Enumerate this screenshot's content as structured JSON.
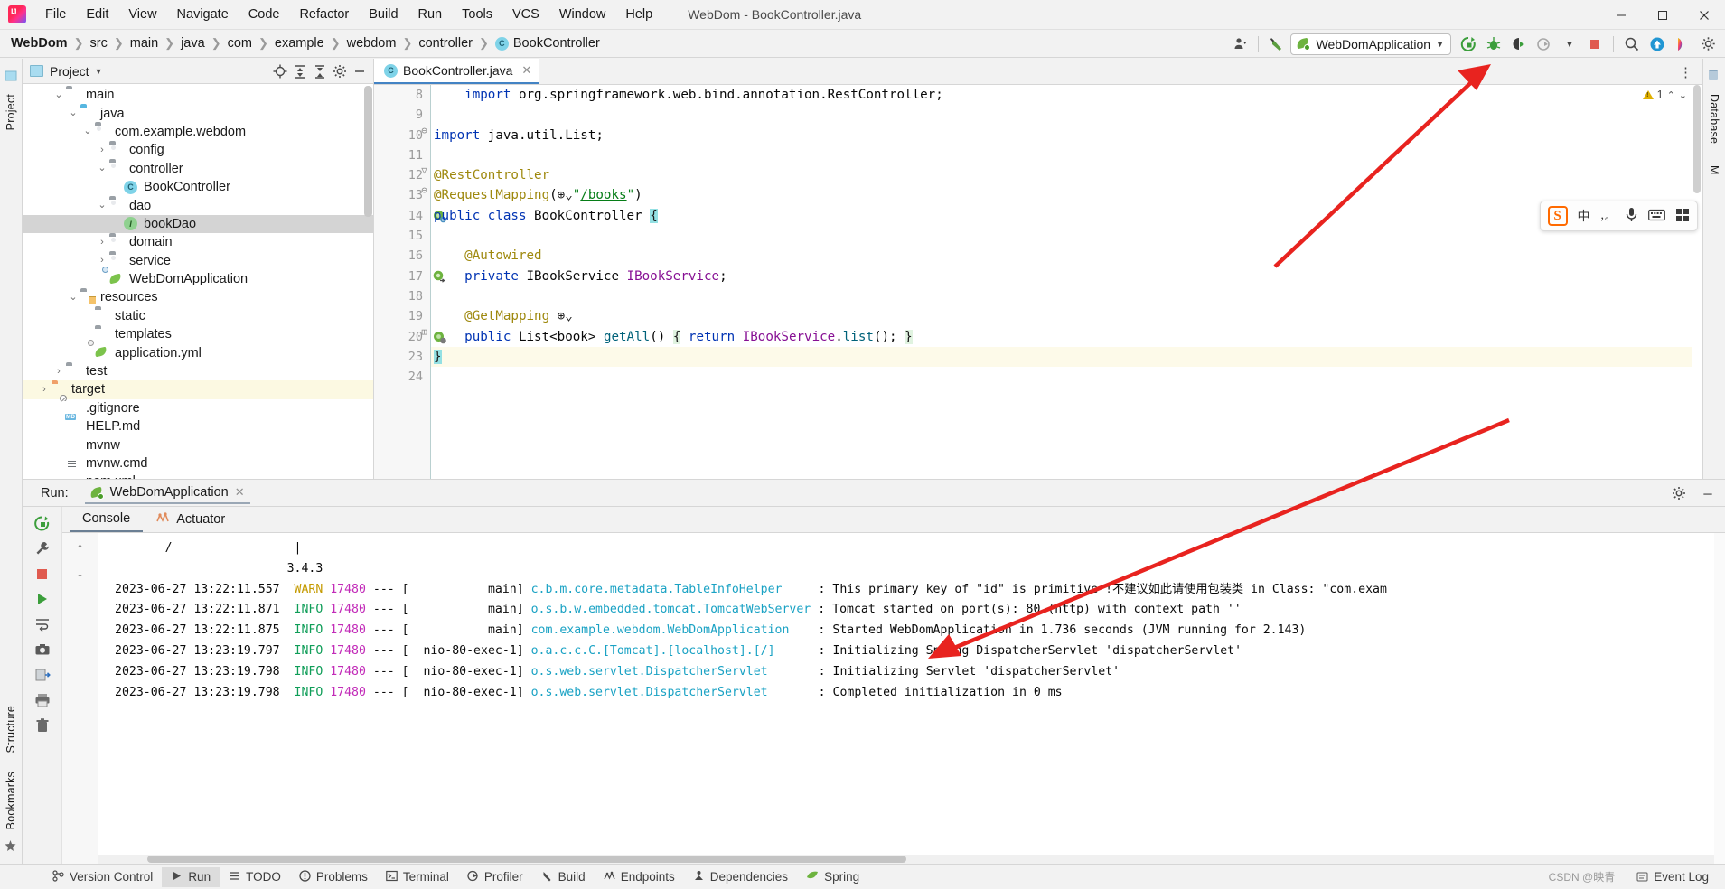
{
  "window": {
    "title": "WebDom - BookController.java",
    "minimize": "─",
    "maximize": "☐",
    "close": "✕"
  },
  "menubar": {
    "items": [
      "File",
      "Edit",
      "View",
      "Navigate",
      "Code",
      "Refactor",
      "Build",
      "Run",
      "Tools",
      "VCS",
      "Window",
      "Help"
    ]
  },
  "breadcrumb": {
    "items": [
      "WebDom",
      "src",
      "main",
      "java",
      "com",
      "example",
      "webdom",
      "controller"
    ],
    "current": "BookController",
    "class_icon": "C"
  },
  "toolbar": {
    "account_icon": "user-icon",
    "hammer_icon": "build-icon",
    "run_config": "WebDomApplication",
    "run_icon": "run-icon",
    "debug_icon": "debug-icon",
    "run_coverage_icon": "run-with-coverage-icon",
    "profiler_icon": "profiler-icon",
    "stop_icon": "stop-icon",
    "search_icon": "search-icon",
    "updates_icon": "updates-icon",
    "ide_icon": "ide-icon",
    "settings_icon": "settings-icon"
  },
  "left_rail": {
    "project_label": "Project",
    "structure_label": "Structure",
    "bookmarks_label": "Bookmarks"
  },
  "right_rail": {
    "database_label": "Database",
    "maven_label": "M"
  },
  "project_panel": {
    "title": "Project",
    "locate_icon": "locate-icon",
    "expand_icon": "expand-all-icon",
    "collapse_icon": "collapse-all-icon",
    "settings_icon": "gear-icon",
    "hide_icon": "hide-icon",
    "tree": [
      {
        "label": "main",
        "depth": 2,
        "twist": "v",
        "icon": "folder-grey",
        "state": ""
      },
      {
        "label": "java",
        "depth": 3,
        "twist": "v",
        "icon": "folder-blue",
        "state": ""
      },
      {
        "label": "com.example.webdom",
        "depth": 4,
        "twist": "v",
        "icon": "folder-pkg",
        "state": ""
      },
      {
        "label": "config",
        "depth": 5,
        "twist": ">",
        "icon": "folder-pkg",
        "state": ""
      },
      {
        "label": "controller",
        "depth": 5,
        "twist": "v",
        "icon": "folder-pkg",
        "state": ""
      },
      {
        "label": "BookController",
        "depth": 6,
        "twist": "",
        "icon": "class",
        "state": ""
      },
      {
        "label": "dao",
        "depth": 5,
        "twist": "v",
        "icon": "folder-pkg",
        "state": ""
      },
      {
        "label": "bookDao",
        "depth": 6,
        "twist": "",
        "icon": "interface",
        "state": "sel"
      },
      {
        "label": "domain",
        "depth": 5,
        "twist": ">",
        "icon": "folder-pkg",
        "state": ""
      },
      {
        "label": "service",
        "depth": 5,
        "twist": ">",
        "icon": "folder-pkg",
        "state": ""
      },
      {
        "label": "WebDomApplication",
        "depth": 5,
        "twist": "",
        "icon": "spring-class",
        "state": ""
      },
      {
        "label": "resources",
        "depth": 3,
        "twist": "v",
        "icon": "folder-res",
        "state": ""
      },
      {
        "label": "static",
        "depth": 4,
        "twist": "",
        "icon": "folder-grey",
        "state": ""
      },
      {
        "label": "templates",
        "depth": 4,
        "twist": "",
        "icon": "folder-grey",
        "state": ""
      },
      {
        "label": "application.yml",
        "depth": 4,
        "twist": "",
        "icon": "spring-yml",
        "state": ""
      },
      {
        "label": "test",
        "depth": 2,
        "twist": ">",
        "icon": "folder-grey",
        "state": ""
      },
      {
        "label": "target",
        "depth": 1,
        "twist": ">",
        "icon": "folder-orange",
        "state": "hl"
      },
      {
        "label": ".gitignore",
        "depth": 2,
        "twist": "",
        "icon": "git-file",
        "state": ""
      },
      {
        "label": "HELP.md",
        "depth": 2,
        "twist": "",
        "icon": "md-file",
        "state": ""
      },
      {
        "label": "mvnw",
        "depth": 2,
        "twist": "",
        "icon": "sh-file",
        "state": ""
      },
      {
        "label": "mvnw.cmd",
        "depth": 2,
        "twist": "",
        "icon": "cmd-file",
        "state": ""
      },
      {
        "label": "pom.xml",
        "depth": 2,
        "twist": "",
        "icon": "maven-file",
        "state": ""
      }
    ]
  },
  "editor": {
    "tab": {
      "label": "BookController.java",
      "icon": "C",
      "close": "✕"
    },
    "kebab": "⋮",
    "inspection": {
      "count": "1",
      "warn_icon": "warning-triangle-icon",
      "up": "⌃",
      "down": "⌄"
    },
    "lines": [
      {
        "no": "8",
        "marker": "",
        "fold": "",
        "text_html": "    <span class='kw'>import</span> <span class='pln'>org.springframework.web.bind.annotation.</span><span class='pln'>RestController</span><span class='pln'>;</span>",
        "current": false
      },
      {
        "no": "9",
        "marker": "",
        "fold": "",
        "text_html": "",
        "current": false
      },
      {
        "no": "10",
        "marker": "",
        "fold": "⊖",
        "text_html": "<span class='kw'>import</span> <span class='pln'>java.util.List;</span>",
        "current": false
      },
      {
        "no": "11",
        "marker": "",
        "fold": "",
        "text_html": "",
        "current": false
      },
      {
        "no": "12",
        "marker": "",
        "fold": "▽",
        "text_html": "<span class='ann'>@RestController</span>",
        "current": false
      },
      {
        "no": "13",
        "marker": "",
        "fold": "⊖",
        "text_html": "<span class='ann'>@RequestMapping</span><span class='pln'>(</span><span class='glb'>⊕⌄</span><span class='str'>\"</span><span class='ulink'>/books</span><span class='str'>\"</span><span class='pln'>)</span>",
        "current": false
      },
      {
        "no": "14",
        "marker": "spring-bean",
        "fold": "",
        "text_html": "<span class='kw'>public class</span> <span class='pln'>BookController</span> <span class='brace-hl'>{</span>",
        "current": false
      },
      {
        "no": "15",
        "marker": "",
        "fold": "",
        "text_html": "",
        "current": false
      },
      {
        "no": "16",
        "marker": "",
        "fold": "",
        "text_html": "    <span class='ann'>@Autowired</span>",
        "current": false
      },
      {
        "no": "17",
        "marker": "spring-arrow",
        "fold": "",
        "text_html": "    <span class='kw'>private</span> <span class='pln'>IBookService</span> <span class='fld'>IBookService</span><span class='pln'>;</span>",
        "current": false
      },
      {
        "no": "18",
        "marker": "",
        "fold": "",
        "text_html": "",
        "current": false
      },
      {
        "no": "19",
        "marker": "",
        "fold": "",
        "text_html": "    <span class='ann'>@GetMapping</span><span class='glb'> ⊕⌄</span>",
        "current": false
      },
      {
        "no": "20",
        "marker": "spring-bean2",
        "fold": "⊞",
        "text_html": "    <span class='kw'>public</span> <span class='pln'>List&lt;book&gt;</span> <span class='mth'>getAll</span><span class='pln'>()</span> <span class='ret-hl'>{</span> <span class='kw'>return</span> <span class='fld'>IBookService</span><span class='pln'>.</span><span class='mth'>list</span><span class='pln'>();</span> <span class='ret-hl'>}</span>",
        "current": false
      },
      {
        "no": "23",
        "marker": "",
        "fold": "",
        "text_html": "<span class='brace-hl'>}</span>",
        "current": true
      },
      {
        "no": "24",
        "marker": "",
        "fold": "",
        "text_html": "",
        "current": false
      }
    ]
  },
  "ime": {
    "logo": "S",
    "lang": "中",
    "comma_icon": "，。",
    "mic_icon": "microphone-icon",
    "keyboard_icon": "keyboard-icon",
    "apps_icon": "apps-icon"
  },
  "run_panel": {
    "label": "Run:",
    "tab": "WebDomApplication",
    "tab_close": "✕",
    "settings_icon": "gear-icon",
    "hide_icon": "─",
    "tabs": [
      {
        "label": "Console",
        "icon": "",
        "active": true
      },
      {
        "label": "Actuator",
        "icon": "actuator-icon",
        "active": false
      }
    ],
    "toolbar_icons": [
      "rerun-icon",
      "wrench-icon",
      "stop-icon",
      "resume-icon",
      "step-icon",
      "camera-icon",
      "export-icon",
      "print-icon",
      "trash-icon"
    ],
    "side_icons": [
      "up-arrow-icon",
      "down-arrow-icon"
    ],
    "banner": {
      "slash": "/",
      "pipe": "|",
      "version": "3.4.3"
    },
    "log": [
      {
        "time": "2023-06-27 13:22:11.557",
        "level": "WARN",
        "pid": "17480",
        "sep": "--- [",
        "thread": "main]",
        "logger": "c.b.m.core.metadata.TableInfoHelper",
        "colon": ":",
        "message": "This primary key of \"id\" is primitive !不建议如此请使用包装类 in Class: \"com.exam"
      },
      {
        "time": "2023-06-27 13:22:11.871",
        "level": "INFO",
        "pid": "17480",
        "sep": "--- [",
        "thread": "main]",
        "logger": "o.s.b.w.embedded.tomcat.TomcatWebServer",
        "colon": ":",
        "message": "Tomcat started on port(s): 80 (http) with context path ''"
      },
      {
        "time": "2023-06-27 13:22:11.875",
        "level": "INFO",
        "pid": "17480",
        "sep": "--- [",
        "thread": "main]",
        "logger": "com.example.webdom.WebDomApplication",
        "colon": ":",
        "message": "Started WebDomApplication in 1.736 seconds (JVM running for 2.143)"
      },
      {
        "time": "2023-06-27 13:23:19.797",
        "level": "INFO",
        "pid": "17480",
        "sep": "--- [",
        "thread": "nio-80-exec-1]",
        "logger": "o.a.c.c.C.[Tomcat].[localhost].[/]",
        "colon": ":",
        "message": "Initializing Spring DispatcherServlet 'dispatcherServlet'"
      },
      {
        "time": "2023-06-27 13:23:19.798",
        "level": "INFO",
        "pid": "17480",
        "sep": "--- [",
        "thread": "nio-80-exec-1]",
        "logger": "o.s.web.servlet.DispatcherServlet",
        "colon": ":",
        "message": "Initializing Servlet 'dispatcherServlet'"
      },
      {
        "time": "2023-06-27 13:23:19.798",
        "level": "INFO",
        "pid": "17480",
        "sep": "--- [",
        "thread": "nio-80-exec-1]",
        "logger": "o.s.web.servlet.DispatcherServlet",
        "colon": ":",
        "message": "Completed initialization in 0 ms"
      }
    ]
  },
  "statusbar": {
    "items": [
      {
        "label": "Version Control",
        "icon": "branch-icon",
        "active": false
      },
      {
        "label": "Run",
        "icon": "play-icon",
        "active": true
      },
      {
        "label": "TODO",
        "icon": "list-icon",
        "active": false
      },
      {
        "label": "Problems",
        "icon": "problems-icon",
        "active": false
      },
      {
        "label": "Terminal",
        "icon": "terminal-icon",
        "active": false
      },
      {
        "label": "Profiler",
        "icon": "profiler-icon",
        "active": false
      },
      {
        "label": "Build",
        "icon": "build-icon",
        "active": false
      },
      {
        "label": "Endpoints",
        "icon": "endpoints-icon",
        "active": false
      },
      {
        "label": "Dependencies",
        "icon": "dependencies-icon",
        "active": false
      },
      {
        "label": "Spring",
        "icon": "spring-icon",
        "active": false
      }
    ],
    "event_log": "Event Log",
    "watermark": "CSDN @映青"
  },
  "annotations": {
    "arrow1": "red-arrow-to-run-button",
    "arrow2": "red-arrow-to-console-log",
    "color": "#e8231f"
  }
}
